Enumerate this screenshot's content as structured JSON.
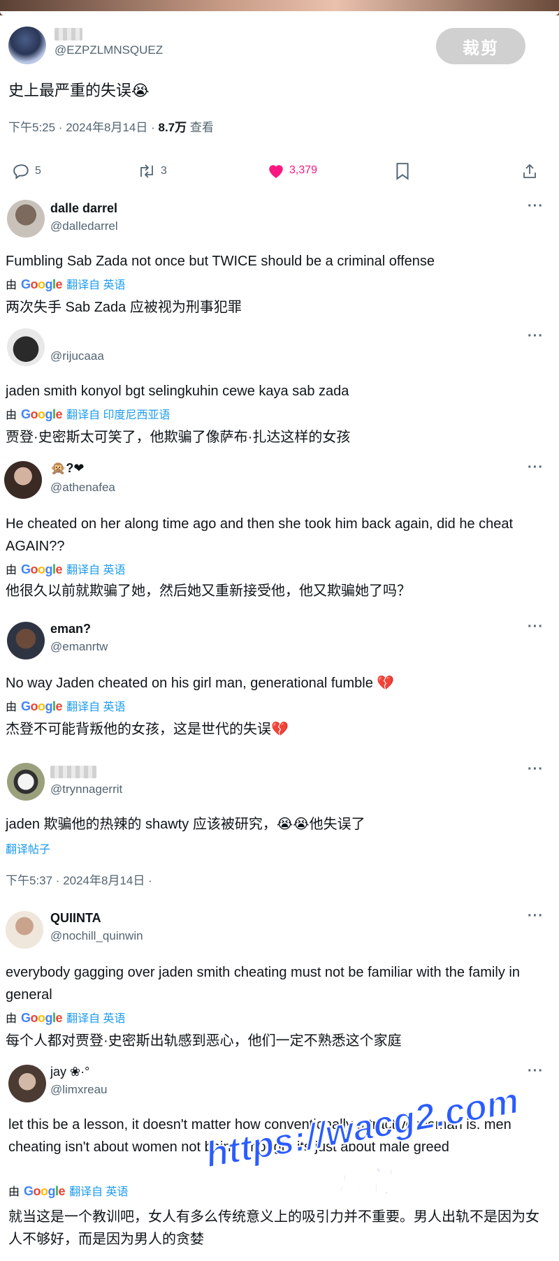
{
  "main_post": {
    "handle": "@EZPZLMNSQUEZ",
    "crop_button": "裁剪",
    "text": "史上最严重的失误😭",
    "time": "下午5:25 · 2024年8月14日 ·",
    "views": "8.7万",
    "views_label": "查看",
    "replies": "5",
    "reposts": "3",
    "likes": "3,379",
    "like_color": "#f91880"
  },
  "google_translate": {
    "by": "由",
    "logo": [
      "G",
      "o",
      "o",
      "g",
      "l",
      "e"
    ]
  },
  "replies": [
    {
      "name": "dalle darrel",
      "handle": "@dalledarrel",
      "text": "Fumbling Sab Zada not once but TWICE should be a criminal offense",
      "translated_label": "翻译自 英语",
      "translation": "两次失手 Sab Zada 应被视为刑事犯罪"
    },
    {
      "name": "",
      "handle": "@rijucaaa",
      "text": "jaden smith konyol bgt selingkuhin cewe kaya sab zada",
      "translated_label": "翻译自 印度尼西亚语",
      "translation": "贾登·史密斯太可笑了，他欺骗了像萨布·扎达这样的女孩"
    },
    {
      "name": "🙊?❤",
      "handle": "@athenafea",
      "text": "He cheated on her along time ago and then she took him back again, did he cheat AGAIN??",
      "translated_label": "翻译自 英语",
      "translation": "他很久以前就欺骗了她，然后她又重新接受他，他又欺骗她了吗？"
    },
    {
      "name": "eman?",
      "handle": "@emanrtw",
      "text": "No way Jaden cheated on his girl man, generational fumble 💔",
      "translated_label": "翻译自 英语",
      "translation": "杰登不可能背叛他的女孩，这是世代的失误💔"
    },
    {
      "name": "",
      "handle": "@trynnagerrit",
      "text": "jaden 欺骗他的热辣的 shawty 应该被研究，😭😭他失误了",
      "translate_post": "翻译帖子",
      "time": "下午5:37 · 2024年8月14日 ·"
    },
    {
      "name": "QUIINTA",
      "handle": "@nochill_quinwin",
      "text": "everybody gagging over jaden smith cheating must not be familiar with the family in general",
      "translated_label": "翻译自 英语",
      "translation": "每个人都对贾登·史密斯出轨感到恶心，他们一定不熟悉这个家庭"
    },
    {
      "name": "jay ❀·°",
      "handle": "@limxreau",
      "text": "let this be a lesson, it doesn't matter how conventionally attractive woman is. men cheating isn't about women not being enough, its just about male greed",
      "translated_label": "翻译自 英语",
      "translation": "就当这是一个教训吧，女人有多么传统意义上的吸引力并不重要。男人出轨不是因为女人不够好，而是因为男人的贪婪"
    }
  ],
  "more_glyph": "···",
  "watermark": {
    "url": "https://wacg2.com",
    "sub": "看完整版"
  }
}
